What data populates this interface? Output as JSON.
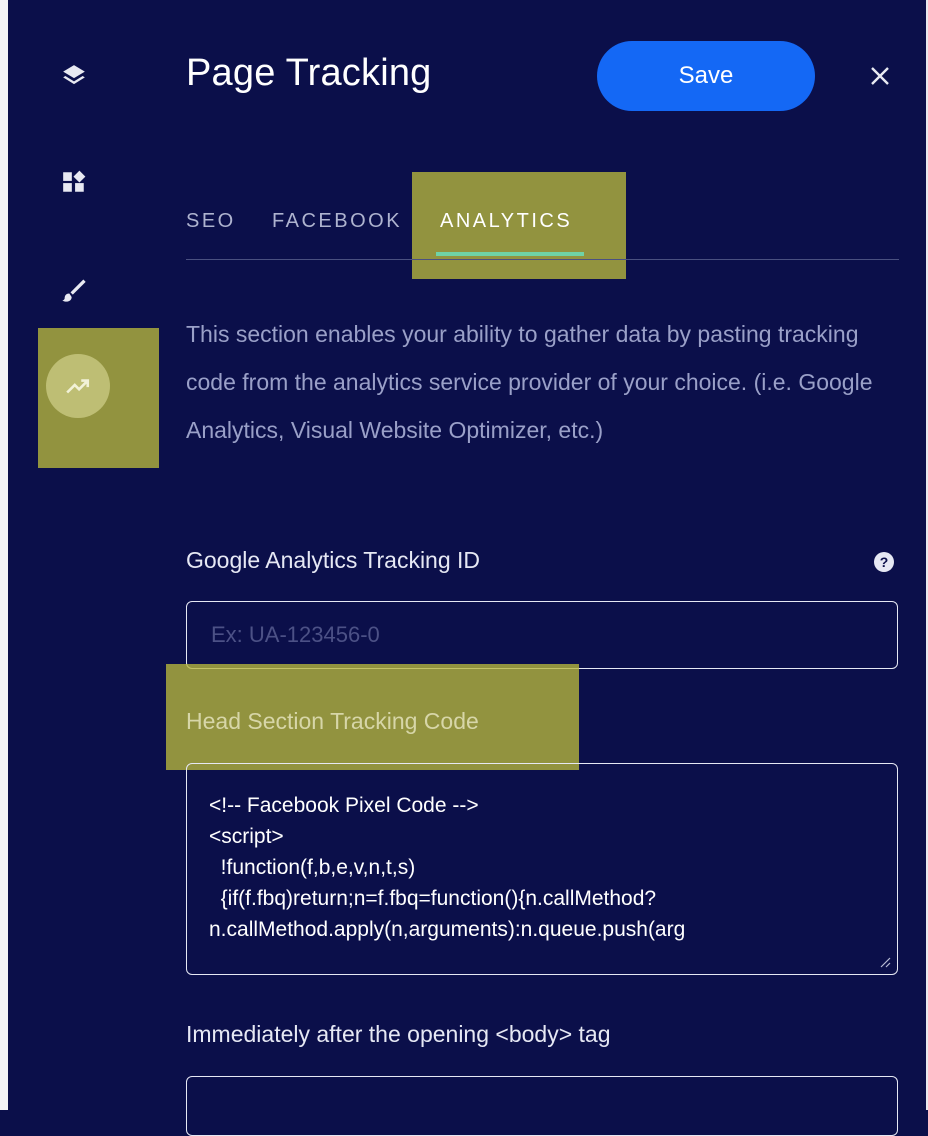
{
  "header": {
    "title": "Page Tracking",
    "save_label": "Save",
    "close_icon": "close-icon"
  },
  "sidebar": {
    "items": [
      {
        "icon": "layers-icon"
      },
      {
        "icon": "widgets-icon"
      },
      {
        "icon": "brush-icon"
      },
      {
        "icon": "trending-up-icon",
        "active": true
      }
    ]
  },
  "tabs": [
    {
      "label": "SEO"
    },
    {
      "label": "FACEBOOK"
    },
    {
      "label": "ANALYTICS",
      "active": true
    }
  ],
  "description": "This section enables your ability to gather data by pasting tracking code from the analytics service provider of your choice. (i.e. Google Analytics, Visual Website Optimizer, etc.)",
  "tracking_id": {
    "label": "Google Analytics Tracking ID",
    "placeholder": "Ex: UA-123456-0",
    "value": ""
  },
  "head_code": {
    "label": "Head Section Tracking Code",
    "lines": [
      "<!-- Facebook Pixel Code -->",
      "<script>",
      "  !function(f,b,e,v,n,t,s)",
      "  {if(f.fbq)return;n=f.fbq=function(){n.callMethod?",
      "",
      "n.callMethod.apply(n,arguments):n.queue.push(arg"
    ]
  },
  "body_code": {
    "label": "Immediately after the opening <body> tag"
  },
  "colors": {
    "background": "#0b0f4a",
    "accent": "#1468f5",
    "tab_indicator": "#6fd3a6",
    "highlight": "#b9b93c"
  }
}
